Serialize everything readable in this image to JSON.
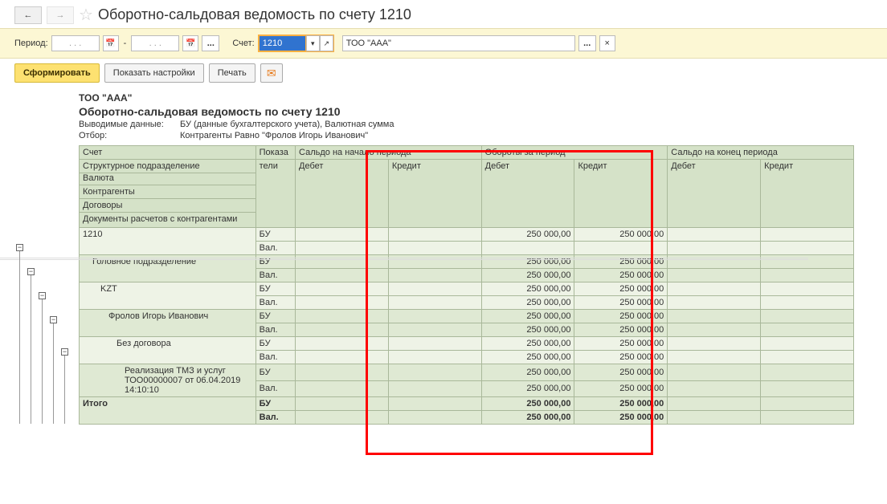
{
  "header": {
    "page_title": "Оборотно-сальдовая ведомость по счету 1210"
  },
  "toolbar1": {
    "period_label": "Период:",
    "date_from": ". .  .",
    "date_to": ". .  .",
    "dots": "...",
    "account_label": "Счет:",
    "account_value": "1210",
    "org_value": "ТОО \"ААА\""
  },
  "toolbar2": {
    "generate": "Сформировать",
    "show_settings": "Показать настройки",
    "print": "Печать"
  },
  "report": {
    "org": "ТОО \"ААА\"",
    "title": "Оборотно-сальдовая ведомость по счету 1210",
    "meta1_label": "Выводимые данные:",
    "meta1_val": "БУ (данные бухгалтерского учета), Валютная сумма",
    "meta2_label": "Отбор:",
    "meta2_val": "Контрагенты Равно \"Фролов Игорь Иванович\""
  },
  "cols": {
    "account": "Счет",
    "indic": "Показа",
    "indic2": "тели",
    "sbeg": "Сальдо на начало периода",
    "turn": "Обороты за период",
    "send": "Сальдо на конец периода",
    "debit": "Дебет",
    "credit": "Кредит",
    "group1": "Структурное подразделение",
    "group2": "Валюта",
    "group3": "Контрагенты",
    "group4": "Договоры",
    "group5": "Документы расчетов с контрагентами"
  },
  "rows": [
    {
      "name": "1210",
      "cls": "r0",
      "ind": "БУ",
      "d": "250 000,00",
      "c": "250 000,00",
      "indent": ""
    },
    {
      "name": "",
      "cls": "r0",
      "ind": "Вал.",
      "d": "",
      "c": "",
      "indent": ""
    },
    {
      "name": "Головное подразделение",
      "cls": "r1",
      "ind": "БУ",
      "d": "250 000,00",
      "c": "250 000,00",
      "indent": "indent1"
    },
    {
      "name": "",
      "cls": "r1",
      "ind": "Вал.",
      "d": "250 000,00",
      "c": "250 000,00",
      "indent": ""
    },
    {
      "name": "KZT",
      "cls": "r0",
      "ind": "БУ",
      "d": "250 000,00",
      "c": "250 000,00",
      "indent": "indent2"
    },
    {
      "name": "",
      "cls": "r0",
      "ind": "Вал.",
      "d": "250 000,00",
      "c": "250 000,00",
      "indent": ""
    },
    {
      "name": "Фролов Игорь Иванович",
      "cls": "r1",
      "ind": "БУ",
      "d": "250 000,00",
      "c": "250 000,00",
      "indent": "indent3"
    },
    {
      "name": "",
      "cls": "r1",
      "ind": "Вал.",
      "d": "250 000,00",
      "c": "250 000,00",
      "indent": ""
    },
    {
      "name": "Без договора",
      "cls": "r0",
      "ind": "БУ",
      "d": "250 000,00",
      "c": "250 000,00",
      "indent": "indent4"
    },
    {
      "name": "",
      "cls": "r0",
      "ind": "Вал.",
      "d": "250 000,00",
      "c": "250 000,00",
      "indent": ""
    },
    {
      "name": "Реализация ТМЗ и услуг ТОО00000007 от 06.04.2019 14:10:10",
      "cls": "r1",
      "ind": "БУ",
      "d": "250 000,00",
      "c": "250 000,00",
      "indent": "indent5",
      "tall": 1
    },
    {
      "name": "",
      "cls": "r1",
      "ind": "Вал.",
      "d": "250 000,00",
      "c": "250 000,00",
      "indent": "",
      "tall": 1
    },
    {
      "name": "Итого",
      "cls": "r1 bold",
      "ind": "БУ",
      "d": "250 000,00",
      "c": "250 000,00",
      "indent": ""
    },
    {
      "name": "",
      "cls": "r1 bold",
      "ind": "Вал.",
      "d": "250 000,00",
      "c": "250 000,00",
      "indent": ""
    }
  ]
}
